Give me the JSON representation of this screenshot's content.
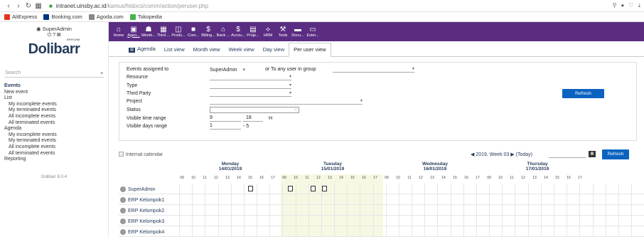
{
  "browser": {
    "url_host": "intranet.uinsby.ac.id",
    "url_path": "/kamus/htdocs/comm/action/peruser.php",
    "bookmarks": [
      {
        "label": "AliExpress",
        "color": "#e43225"
      },
      {
        "label": "Booking.com",
        "color": "#003580"
      },
      {
        "label": "Agoda.com",
        "color": "#888888"
      },
      {
        "label": "Tokopedia",
        "color": "#42b549"
      }
    ]
  },
  "user": {
    "name": "SuperAdmin"
  },
  "logo": {
    "text": "Dolibarr",
    "tag": "ERP/CRM"
  },
  "search": {
    "placeholder": "Search"
  },
  "menu": [
    {
      "label": "Events",
      "level": "title"
    },
    {
      "label": "New event",
      "level": "lvl1"
    },
    {
      "label": "List",
      "level": "lvl1"
    },
    {
      "label": "My incomplete events",
      "level": "lvl2"
    },
    {
      "label": "My terminated events",
      "level": "lvl2"
    },
    {
      "label": "All incomplete events",
      "level": "lvl2"
    },
    {
      "label": "All terminated events",
      "level": "lvl2"
    },
    {
      "label": "Agenda",
      "level": "lvl1"
    },
    {
      "label": "My incomplete events",
      "level": "lvl2"
    },
    {
      "label": "My terminated events",
      "level": "lvl2"
    },
    {
      "label": "All incomplete events",
      "level": "lvl2"
    },
    {
      "label": "All terminated events",
      "level": "lvl2"
    },
    {
      "label": "Reporting",
      "level": "lvl1"
    }
  ],
  "version": "Dolibarr 8.0.4",
  "topmenu": [
    {
      "label": "Home",
      "icon": "⌂"
    },
    {
      "label": "Agen...",
      "icon": "▣",
      "active": true
    },
    {
      "label": "Memb...",
      "icon": "☗"
    },
    {
      "label": "Third ...",
      "icon": "▦"
    },
    {
      "label": "Produ...",
      "icon": "◫"
    },
    {
      "label": "Com...",
      "icon": "■"
    },
    {
      "label": "Billing...",
      "icon": "$"
    },
    {
      "label": "Bank ...",
      "icon": "⌂"
    },
    {
      "label": "Accou...",
      "icon": "$"
    },
    {
      "label": "Proje...",
      "icon": "▤"
    },
    {
      "label": "HRM",
      "icon": "⟡"
    },
    {
      "label": "Tools",
      "icon": "⚒"
    },
    {
      "label": "Docu...",
      "icon": "▬"
    },
    {
      "label": "Exter...",
      "icon": "▭"
    }
  ],
  "tabs": [
    "Agenda",
    "List view",
    "Month view",
    "Week view",
    "Day view",
    "Per user view"
  ],
  "filters": {
    "assigned_label": "Events assigned to",
    "assigned_value": "SuperAdmin",
    "group_label": "or To any user in group",
    "resource_label": "Resource",
    "type_label": "Type",
    "thirdparty_label": "Third Party",
    "project_label": "Project",
    "status_label": "Status",
    "time_label": "Visible time range",
    "time_from": "9",
    "time_to": "18",
    "time_unit": "H",
    "days_label": "Visible days range",
    "days_from": "1",
    "days_to": "- 5",
    "refresh": "Refresh"
  },
  "calendar": {
    "internal_label": "Internal calendar",
    "week_label": "2019, Week 03",
    "today_label": "(Today)",
    "refresh": "Refresh",
    "days": [
      {
        "name": "Monday",
        "date": "14/01/2019"
      },
      {
        "name": "Tuesday",
        "date": "15/01/2019"
      },
      {
        "name": "Wednesday",
        "date": "16/01/2019"
      },
      {
        "name": "Thursday",
        "date": "17/01/2019"
      }
    ],
    "hours": [
      "09",
      "10",
      "11",
      "12",
      "13",
      "14",
      "15",
      "16",
      "17"
    ],
    "users": [
      "SuperAdmin",
      "ERP Kelompok1",
      "ERP Kelompok2",
      "ERP Kelompok3",
      "ERP Kelompok4"
    ]
  }
}
